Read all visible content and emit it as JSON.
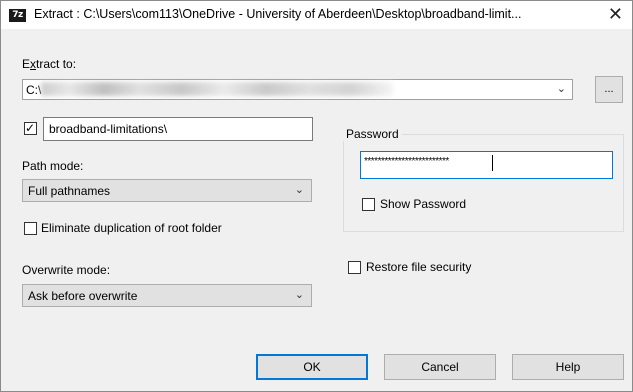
{
  "titlebar": {
    "app_icon": "7z",
    "title": "Extract : C:\\Users\\com113\\OneDrive - University of Aberdeen\\Desktop\\broadband-limit...",
    "close_icon": "✕"
  },
  "extract_to": {
    "label_first": "E",
    "label_underlined": "x",
    "label_rest": "tract to:",
    "path_value": "C:\\",
    "browse_label": "..."
  },
  "subfolder": {
    "checked": true,
    "value": "broadband-limitations\\"
  },
  "path_mode": {
    "label": "Path mode:",
    "selected": "Full pathnames"
  },
  "eliminate_duplication": {
    "checked": false,
    "label": "Eliminate duplication of root folder"
  },
  "overwrite_mode": {
    "label": "Overwrite mode:",
    "selected": "Ask before overwrite"
  },
  "password": {
    "group_label": "Password",
    "masked_value": "*************************",
    "show_password_checked": false,
    "show_password_label": "Show Password"
  },
  "restore_security": {
    "checked": false,
    "label": "Restore file security"
  },
  "buttons": {
    "ok": "OK",
    "cancel": "Cancel",
    "help": "Help"
  }
}
